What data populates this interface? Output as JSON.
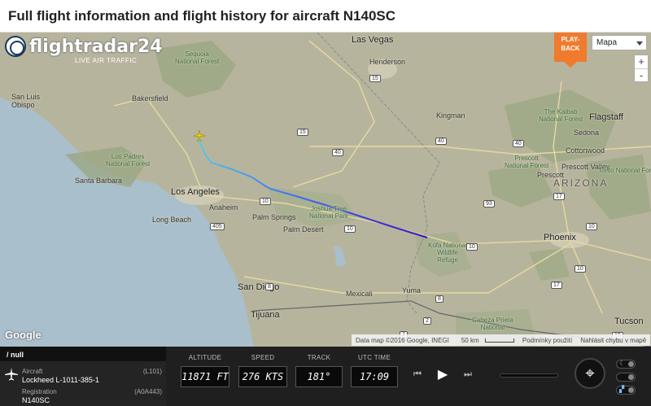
{
  "page": {
    "title": "Full flight information and flight history for aircraft N140SC"
  },
  "map": {
    "logo": {
      "brand": "flightradar24",
      "tagline": "LIVE AIR TRAFFIC"
    },
    "playback_label_1": "PLAY-",
    "playback_label_2": "BACK",
    "map_type": "Mapa",
    "zoom_in": "+",
    "zoom_out": "-",
    "google": "Google",
    "attribution": {
      "data": "Data map ©2016 Google, INEGI",
      "scale": "50 km",
      "terms": "Podmínky použití",
      "report": "Nahlásit chybu v mapě"
    },
    "labels": {
      "las_vegas": "Las Vegas",
      "henderson": "Henderson",
      "bakersfield": "Bakersfield",
      "san_luis_obispo_1": "San Luis",
      "san_luis_obispo_2": "Obispo",
      "sequoia_1": "Sequoia",
      "sequoia_2": "National Forest",
      "kingman": "Kingman",
      "flagstaff": "Flagstaff",
      "kaibab_1": "The Kaibab",
      "kaibab_2": "National Forest",
      "sedona": "Sedona",
      "cottonwood": "Cottonwood",
      "prescott_1": "Prescott",
      "prescott_2": "National Forest",
      "prescott_city": "Prescott",
      "prescott_valley": "Prescott Valley",
      "tonto": "Tonto National Forest",
      "arizona": "ARIZONA",
      "los_padres_1": "Los Padres",
      "los_padres_2": "National Forest",
      "santa_barbara": "Santa Barbara",
      "los_angeles": "Los Angeles",
      "anaheim": "Anaheim",
      "long_beach": "Long Beach",
      "palm_springs": "Palm Springs",
      "palm_desert": "Palm Desert",
      "joshua_1": "Joshua Tree",
      "joshua_2": "National Park",
      "phoenix": "Phoenix",
      "kofa_1": "Kofa National",
      "kofa_2": "Wildlife",
      "kofa_3": "Refuge",
      "san_diego": "San Diego",
      "tijuana": "Tijuana",
      "mexicali": "Mexicali",
      "yuma": "Yuma",
      "tucson": "Tucson",
      "cabeza_1": "Cabeza Prieta",
      "cabeza_2": "National"
    },
    "shields": [
      "15",
      "40",
      "40",
      "40",
      "15",
      "17",
      "17",
      "10",
      "10",
      "405",
      "10",
      "8",
      "8",
      "10",
      "10",
      "93",
      "2",
      "2",
      "19"
    ]
  },
  "panel": {
    "header": "/ null",
    "aircraft_label": "Aircraft",
    "aircraft_code": "(L101)",
    "aircraft_value": "Lockheed L-1011-385-1",
    "registration_label": "Registration",
    "registration_code": "(A0A443)",
    "registration_value": "N140SC",
    "altitude_label": "ALTITUDE",
    "altitude_value": "11871 FT",
    "speed_label": "SPEED",
    "speed_value": "276 KTS",
    "track_label": "TRACK",
    "track_value": "181°",
    "utc_label": "UTC TIME",
    "utc_value": "17:09",
    "rewind": "⏮",
    "play": "▶",
    "forward": "⏭",
    "center": "⌖"
  },
  "colors": {
    "map_land": "#b9b69f",
    "forest": "#8fa07a",
    "track_start": "#56c8e8",
    "track_end": "#3a10c8",
    "playback": "#f07a2e",
    "panel": "#1f1f1f"
  }
}
